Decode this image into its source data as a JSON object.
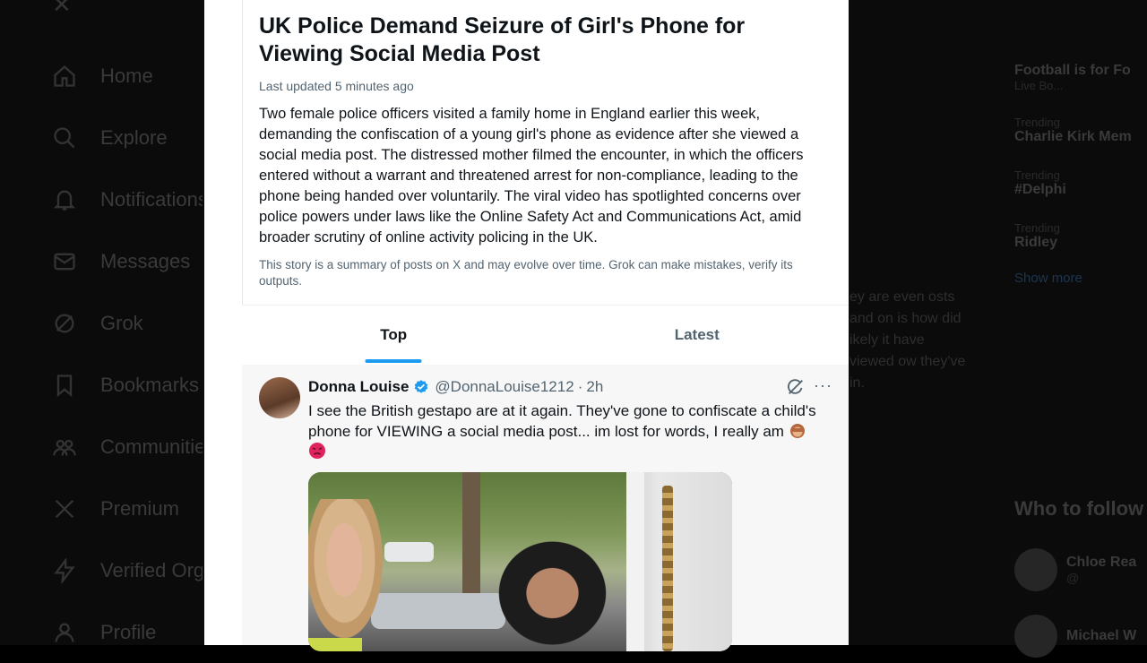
{
  "background": {
    "top_icon": "x-logo-icon",
    "nav": [
      {
        "label": "Home",
        "icon": "home-icon"
      },
      {
        "label": "Explore",
        "icon": "search-icon"
      },
      {
        "label": "Notifications",
        "icon": "bell-icon"
      },
      {
        "label": "Messages",
        "icon": "mail-icon"
      },
      {
        "label": "Grok",
        "icon": "grok-icon"
      },
      {
        "label": "Bookmarks",
        "icon": "bookmark-icon"
      },
      {
        "label": "Communities",
        "icon": "people-icon"
      },
      {
        "label": "Premium",
        "icon": "x-logo-icon"
      },
      {
        "label": "Verified Orgs",
        "icon": "lightning-icon"
      },
      {
        "label": "Profile",
        "icon": "person-icon"
      }
    ],
    "trends": [
      {
        "meta": "",
        "title": "Football is for Fo",
        "sub": "Live Bo..."
      },
      {
        "meta": "Trending",
        "title": "Charlie Kirk Mem",
        "sub": ""
      },
      {
        "meta": "Trending",
        "title": "#Delphi",
        "sub": ""
      },
      {
        "meta": "Trending",
        "title": "Ridley",
        "sub": ""
      }
    ],
    "show_more": "Show more",
    "who_to_follow": "Who to follow",
    "follow": [
      {
        "name": "Chloe Rea",
        "handle": "@"
      },
      {
        "name": "Michael W",
        "handle": ""
      }
    ],
    "ghost_post_text": "ey are even osts and on is how did ikely it have viewed ow they've in."
  },
  "story": {
    "title": "UK Police Demand Seizure of Girl's Phone for Viewing Social Media Post",
    "updated": "Last updated 5 minutes ago",
    "summary": "Two female police officers visited a family home in England earlier this week, demanding the confiscation of a young girl's phone as evidence after she viewed a social media post. The distressed mother filmed the encounter, in which the officers entered without a warrant and threatened arrest for non-compliance, leading to the phone being handed over voluntarily. The viral video has spotlighted concerns over police powers under laws like the Online Safety Act and Communications Act, amid broader scrutiny of online activity policing in the UK.",
    "disclaimer": "This story is a summary of posts on X and may evolve over time. Grok can make mistakes, verify its outputs."
  },
  "tabs": {
    "top": "Top",
    "latest": "Latest",
    "active": "Top"
  },
  "post": {
    "name": "Donna Louise",
    "handle": "@DonnaLouise1212",
    "separator": "·",
    "time": "2h",
    "text": "I see the British gestapo are at it again. They've gone to confiscate a child's phone for VIEWING a social media post... im lost for words, I really am",
    "emojis": [
      "see-no-evil-monkey-icon",
      "angry-face-icon"
    ],
    "media_alt": "video-thumbnail"
  },
  "colors": {
    "accent": "#1d9bf0",
    "text_primary": "#0f1419",
    "text_secondary": "#536471",
    "post_bg": "#f7f7f7"
  }
}
